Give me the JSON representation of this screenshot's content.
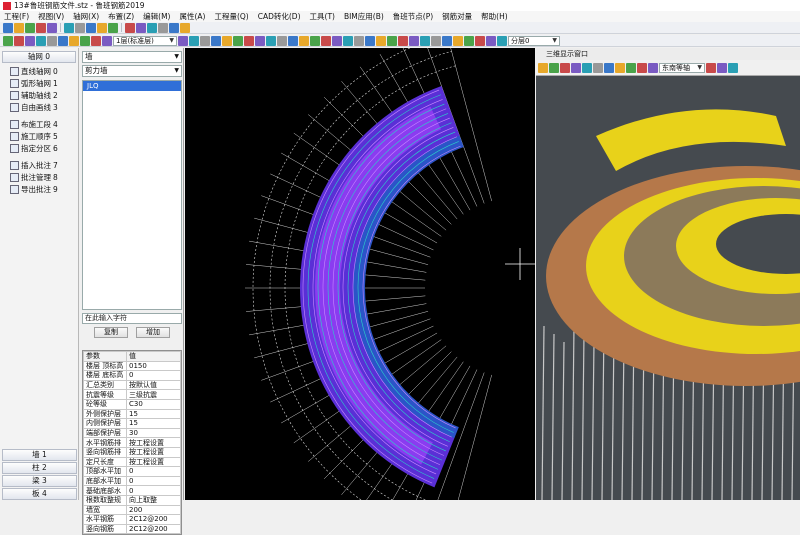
{
  "app": {
    "title": "13#鲁班钢筋文件.stz - 鲁班钢筋2019"
  },
  "menu": [
    "工程(F)",
    "视图(V)",
    "轴网(X)",
    "布置(Z)",
    "编辑(M)",
    "属性(A)",
    "工程量(Q)",
    "CAD转化(D)",
    "工具(T)",
    "BIM应用(B)",
    "鲁班节点(P)",
    "钢筋对量",
    "帮助(H)"
  ],
  "toolbar": {
    "floor_label": "1层(标准层)",
    "layer_label": "分层0"
  },
  "left_nav": {
    "header": "轴网 0",
    "group1": [
      {
        "label": "直线轴网",
        "key": "0",
        "icon": "straight-axis-icon"
      },
      {
        "label": "弧形轴网",
        "key": "1",
        "icon": "arc-axis-icon"
      },
      {
        "label": "辅助轴线",
        "key": "2",
        "icon": "aux-axis-icon"
      },
      {
        "label": "自由画线",
        "key": "3",
        "icon": "freehand-line-icon"
      }
    ],
    "group2": [
      {
        "label": "布施工段",
        "key": "4",
        "icon": "construction-section-icon"
      },
      {
        "label": "施工顺序",
        "key": "5",
        "icon": "construction-order-icon"
      },
      {
        "label": "指定分区",
        "key": "6",
        "icon": "zone-icon"
      }
    ],
    "group3": [
      {
        "label": "插入批注",
        "key": "7",
        "icon": "insert-note-icon"
      },
      {
        "label": "批注管理",
        "key": "8",
        "icon": "note-manage-icon"
      },
      {
        "label": "导出批注",
        "key": "9",
        "icon": "export-note-icon"
      }
    ],
    "bottom_tabs": [
      "墙 1",
      "柱 2",
      "梁 3",
      "板 4"
    ]
  },
  "component_panel": {
    "type_select": "墙",
    "subtype_select": "剪力墙",
    "list_items": [
      "JLQ"
    ],
    "search_placeholder": "在此输入字符",
    "copy_label": "复制",
    "add_label": "增加",
    "props_header": {
      "k": "参数",
      "v": "值"
    },
    "props": [
      {
        "k": "楼层 顶标高",
        "v": "0150"
      },
      {
        "k": "楼层 底标高",
        "v": "0"
      },
      {
        "k": "汇总类别",
        "v": "按默认值"
      },
      {
        "k": "抗震等级",
        "v": "三级抗震"
      },
      {
        "k": "砼等级",
        "v": "C30"
      },
      {
        "k": "外侧保护层",
        "v": "15"
      },
      {
        "k": "内侧保护层",
        "v": "15"
      },
      {
        "k": "端部保护层",
        "v": "30"
      },
      {
        "k": "水平钢筋排",
        "v": "按工程设置"
      },
      {
        "k": "竖向钢筋排",
        "v": "按工程设置"
      },
      {
        "k": "定尺长度",
        "v": "按工程设置"
      },
      {
        "k": "顶部水平加",
        "v": "0"
      },
      {
        "k": "底部水平加",
        "v": "0"
      },
      {
        "k": "基础底部水",
        "v": "0"
      },
      {
        "k": "根数取整规",
        "v": "向上取整"
      },
      {
        "k": "墙宽",
        "v": "200"
      },
      {
        "k": "水平钢筋",
        "v": "2C12@200"
      },
      {
        "k": "竖向钢筋",
        "v": "2C12@200"
      }
    ]
  },
  "view3d": {
    "title": "三维显示窗口",
    "view_select": "东南等轴"
  },
  "colors": {
    "menu_bg": "#f6f6f6",
    "cad_bg": "#000000",
    "wall_purple": "#6a3cf0",
    "rebar_yellow": "#e8d21a",
    "slab_brown": "#b5784a",
    "selected_row": "#2f6fd8"
  }
}
